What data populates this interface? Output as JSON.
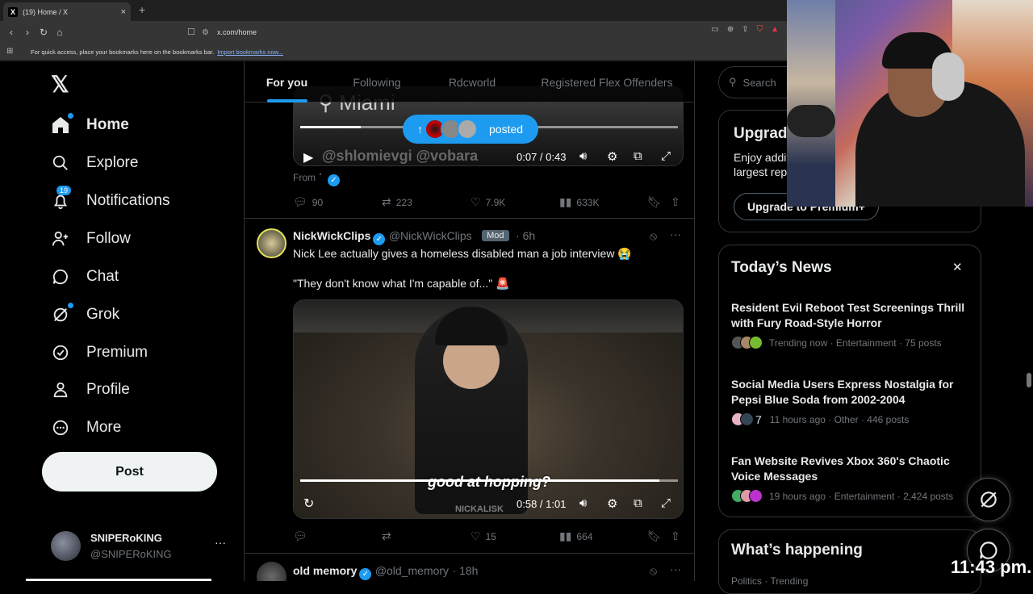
{
  "browser": {
    "tab_title": "(19) Home / X",
    "tab_favicon": "X",
    "tab_close": "×",
    "new_tab": "+",
    "url": "x.com/home",
    "bookmark_hint": "For quick access, place your bookmarks here on the bookmarks bar.",
    "bookmark_link": "Import bookmarks now..."
  },
  "sidebar": {
    "logo": "𝕏",
    "items": [
      {
        "label": "Home",
        "icon": "home-icon"
      },
      {
        "label": "Explore",
        "icon": "search-icon"
      },
      {
        "label": "Notifications",
        "icon": "bell-icon",
        "badge": "19"
      },
      {
        "label": "Follow",
        "icon": "add-person-icon"
      },
      {
        "label": "Chat",
        "icon": "chat-icon"
      },
      {
        "label": "Grok",
        "icon": "grok-icon"
      },
      {
        "label": "Premium",
        "icon": "verified-icon"
      },
      {
        "label": "Profile",
        "icon": "person-icon"
      },
      {
        "label": "More",
        "icon": "more-circle-icon"
      }
    ],
    "post_label": "Post",
    "account": {
      "name": "SNIPERoKING",
      "handle": "@SNIPERoKING",
      "menu": "···"
    }
  },
  "feed": {
    "tabs": [
      "For you",
      "Following",
      "Rdcworld",
      "Registered Flex Offenders"
    ],
    "posted_pill": "posted",
    "tweet1": {
      "video_overlay_text": "Miami",
      "video_watermark": "@shlomievgi @vobara",
      "time": "0:07 / 0:43",
      "progress": 0.16,
      "from_label": "From",
      "stats": {
        "replies": "90",
        "reposts": "223",
        "likes": "7.9K",
        "views": "633K"
      }
    },
    "tweet2": {
      "name": "NickWickClips",
      "handle": "@NickWickClips",
      "mod": "Mod",
      "time": "6h",
      "text1": "Nick Lee actually gives a homeless disabled man a job interview 😭",
      "text2": "\"They don't know what I'm capable of...\" 🚨",
      "caption": "good at hopping?",
      "watermark": "NICKALISK",
      "video_time": "0:58 / 1:01",
      "progress": 0.95,
      "stats": {
        "replies": "",
        "reposts": "",
        "likes": "15",
        "views": "664"
      }
    },
    "tweet3": {
      "name": "old memory",
      "handle": "@old_memory",
      "time": "· 18h"
    }
  },
  "right": {
    "search_placeholder": "Search",
    "premium_title": "Upgrad",
    "premium_text1": "Enjoy addit",
    "premium_text2": "largest rep",
    "premium_button": "Upgrade to Premium+",
    "news_title": "Today’s News",
    "news_close": "✕",
    "news": [
      {
        "title": "Resident Evil Reboot Test Screenings Thrill with Fury Road-Style Horror",
        "meta": "Trending now · Entertainment · 75 posts"
      },
      {
        "title": "Social Media Users Express Nostalgia for Pepsi Blue Soda from 2002-2004",
        "meta": "11 hours ago · Other · 446 posts",
        "count_prefix": "7"
      },
      {
        "title": "Fan Website Revives Xbox 360's Chaotic Voice Messages",
        "meta": "19 hours ago · Entertainment · 2,424 posts"
      }
    ],
    "whats_happening": "What’s happening",
    "whats_sub": "Politics · Trending"
  },
  "overlay": {
    "clock": "11:43 pm."
  },
  "colors": {
    "accent": "#1d9bf0",
    "bg": "#000000",
    "muted": "#71767b",
    "border": "#2f3336"
  }
}
